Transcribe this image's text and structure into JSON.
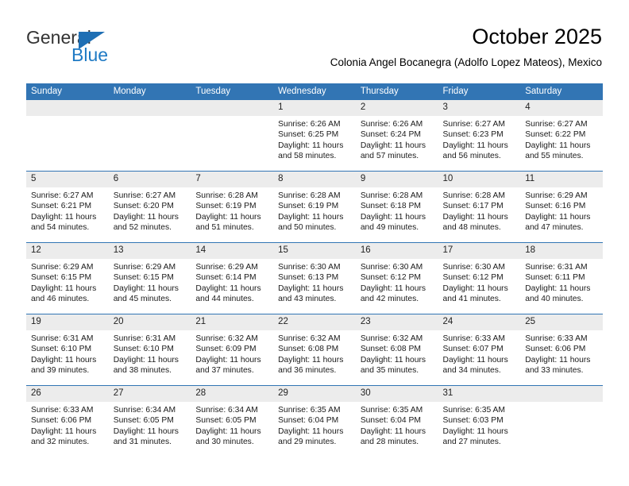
{
  "brand": {
    "name_part1": "General",
    "name_part2": "Blue",
    "flag_color": "#1f6fb4",
    "blue_text_color": "#1f7ac4"
  },
  "header": {
    "title": "October 2025",
    "subtitle": "Colonia Angel Bocanegra (Adolfo Lopez Mateos), Mexico",
    "accent_color": "#3275b4",
    "daynum_band_color": "#ececec"
  },
  "weekday_headers": [
    "Sunday",
    "Monday",
    "Tuesday",
    "Wednesday",
    "Thursday",
    "Friday",
    "Saturday"
  ],
  "weeks": [
    [
      {
        "day": "",
        "empty": true,
        "sunrise": "",
        "sunset": "",
        "daylight_line1": "",
        "daylight_line2": ""
      },
      {
        "day": "",
        "empty": true,
        "sunrise": "",
        "sunset": "",
        "daylight_line1": "",
        "daylight_line2": ""
      },
      {
        "day": "",
        "empty": true,
        "sunrise": "",
        "sunset": "",
        "daylight_line1": "",
        "daylight_line2": ""
      },
      {
        "day": "1",
        "empty": false,
        "sunrise": "Sunrise: 6:26 AM",
        "sunset": "Sunset: 6:25 PM",
        "daylight_line1": "Daylight: 11 hours",
        "daylight_line2": "and 58 minutes."
      },
      {
        "day": "2",
        "empty": false,
        "sunrise": "Sunrise: 6:26 AM",
        "sunset": "Sunset: 6:24 PM",
        "daylight_line1": "Daylight: 11 hours",
        "daylight_line2": "and 57 minutes."
      },
      {
        "day": "3",
        "empty": false,
        "sunrise": "Sunrise: 6:27 AM",
        "sunset": "Sunset: 6:23 PM",
        "daylight_line1": "Daylight: 11 hours",
        "daylight_line2": "and 56 minutes."
      },
      {
        "day": "4",
        "empty": false,
        "sunrise": "Sunrise: 6:27 AM",
        "sunset": "Sunset: 6:22 PM",
        "daylight_line1": "Daylight: 11 hours",
        "daylight_line2": "and 55 minutes."
      }
    ],
    [
      {
        "day": "5",
        "empty": false,
        "sunrise": "Sunrise: 6:27 AM",
        "sunset": "Sunset: 6:21 PM",
        "daylight_line1": "Daylight: 11 hours",
        "daylight_line2": "and 54 minutes."
      },
      {
        "day": "6",
        "empty": false,
        "sunrise": "Sunrise: 6:27 AM",
        "sunset": "Sunset: 6:20 PM",
        "daylight_line1": "Daylight: 11 hours",
        "daylight_line2": "and 52 minutes."
      },
      {
        "day": "7",
        "empty": false,
        "sunrise": "Sunrise: 6:28 AM",
        "sunset": "Sunset: 6:19 PM",
        "daylight_line1": "Daylight: 11 hours",
        "daylight_line2": "and 51 minutes."
      },
      {
        "day": "8",
        "empty": false,
        "sunrise": "Sunrise: 6:28 AM",
        "sunset": "Sunset: 6:19 PM",
        "daylight_line1": "Daylight: 11 hours",
        "daylight_line2": "and 50 minutes."
      },
      {
        "day": "9",
        "empty": false,
        "sunrise": "Sunrise: 6:28 AM",
        "sunset": "Sunset: 6:18 PM",
        "daylight_line1": "Daylight: 11 hours",
        "daylight_line2": "and 49 minutes."
      },
      {
        "day": "10",
        "empty": false,
        "sunrise": "Sunrise: 6:28 AM",
        "sunset": "Sunset: 6:17 PM",
        "daylight_line1": "Daylight: 11 hours",
        "daylight_line2": "and 48 minutes."
      },
      {
        "day": "11",
        "empty": false,
        "sunrise": "Sunrise: 6:29 AM",
        "sunset": "Sunset: 6:16 PM",
        "daylight_line1": "Daylight: 11 hours",
        "daylight_line2": "and 47 minutes."
      }
    ],
    [
      {
        "day": "12",
        "empty": false,
        "sunrise": "Sunrise: 6:29 AM",
        "sunset": "Sunset: 6:15 PM",
        "daylight_line1": "Daylight: 11 hours",
        "daylight_line2": "and 46 minutes."
      },
      {
        "day": "13",
        "empty": false,
        "sunrise": "Sunrise: 6:29 AM",
        "sunset": "Sunset: 6:15 PM",
        "daylight_line1": "Daylight: 11 hours",
        "daylight_line2": "and 45 minutes."
      },
      {
        "day": "14",
        "empty": false,
        "sunrise": "Sunrise: 6:29 AM",
        "sunset": "Sunset: 6:14 PM",
        "daylight_line1": "Daylight: 11 hours",
        "daylight_line2": "and 44 minutes."
      },
      {
        "day": "15",
        "empty": false,
        "sunrise": "Sunrise: 6:30 AM",
        "sunset": "Sunset: 6:13 PM",
        "daylight_line1": "Daylight: 11 hours",
        "daylight_line2": "and 43 minutes."
      },
      {
        "day": "16",
        "empty": false,
        "sunrise": "Sunrise: 6:30 AM",
        "sunset": "Sunset: 6:12 PM",
        "daylight_line1": "Daylight: 11 hours",
        "daylight_line2": "and 42 minutes."
      },
      {
        "day": "17",
        "empty": false,
        "sunrise": "Sunrise: 6:30 AM",
        "sunset": "Sunset: 6:12 PM",
        "daylight_line1": "Daylight: 11 hours",
        "daylight_line2": "and 41 minutes."
      },
      {
        "day": "18",
        "empty": false,
        "sunrise": "Sunrise: 6:31 AM",
        "sunset": "Sunset: 6:11 PM",
        "daylight_line1": "Daylight: 11 hours",
        "daylight_line2": "and 40 minutes."
      }
    ],
    [
      {
        "day": "19",
        "empty": false,
        "sunrise": "Sunrise: 6:31 AM",
        "sunset": "Sunset: 6:10 PM",
        "daylight_line1": "Daylight: 11 hours",
        "daylight_line2": "and 39 minutes."
      },
      {
        "day": "20",
        "empty": false,
        "sunrise": "Sunrise: 6:31 AM",
        "sunset": "Sunset: 6:10 PM",
        "daylight_line1": "Daylight: 11 hours",
        "daylight_line2": "and 38 minutes."
      },
      {
        "day": "21",
        "empty": false,
        "sunrise": "Sunrise: 6:32 AM",
        "sunset": "Sunset: 6:09 PM",
        "daylight_line1": "Daylight: 11 hours",
        "daylight_line2": "and 37 minutes."
      },
      {
        "day": "22",
        "empty": false,
        "sunrise": "Sunrise: 6:32 AM",
        "sunset": "Sunset: 6:08 PM",
        "daylight_line1": "Daylight: 11 hours",
        "daylight_line2": "and 36 minutes."
      },
      {
        "day": "23",
        "empty": false,
        "sunrise": "Sunrise: 6:32 AM",
        "sunset": "Sunset: 6:08 PM",
        "daylight_line1": "Daylight: 11 hours",
        "daylight_line2": "and 35 minutes."
      },
      {
        "day": "24",
        "empty": false,
        "sunrise": "Sunrise: 6:33 AM",
        "sunset": "Sunset: 6:07 PM",
        "daylight_line1": "Daylight: 11 hours",
        "daylight_line2": "and 34 minutes."
      },
      {
        "day": "25",
        "empty": false,
        "sunrise": "Sunrise: 6:33 AM",
        "sunset": "Sunset: 6:06 PM",
        "daylight_line1": "Daylight: 11 hours",
        "daylight_line2": "and 33 minutes."
      }
    ],
    [
      {
        "day": "26",
        "empty": false,
        "sunrise": "Sunrise: 6:33 AM",
        "sunset": "Sunset: 6:06 PM",
        "daylight_line1": "Daylight: 11 hours",
        "daylight_line2": "and 32 minutes."
      },
      {
        "day": "27",
        "empty": false,
        "sunrise": "Sunrise: 6:34 AM",
        "sunset": "Sunset: 6:05 PM",
        "daylight_line1": "Daylight: 11 hours",
        "daylight_line2": "and 31 minutes."
      },
      {
        "day": "28",
        "empty": false,
        "sunrise": "Sunrise: 6:34 AM",
        "sunset": "Sunset: 6:05 PM",
        "daylight_line1": "Daylight: 11 hours",
        "daylight_line2": "and 30 minutes."
      },
      {
        "day": "29",
        "empty": false,
        "sunrise": "Sunrise: 6:35 AM",
        "sunset": "Sunset: 6:04 PM",
        "daylight_line1": "Daylight: 11 hours",
        "daylight_line2": "and 29 minutes."
      },
      {
        "day": "30",
        "empty": false,
        "sunrise": "Sunrise: 6:35 AM",
        "sunset": "Sunset: 6:04 PM",
        "daylight_line1": "Daylight: 11 hours",
        "daylight_line2": "and 28 minutes."
      },
      {
        "day": "31",
        "empty": false,
        "sunrise": "Sunrise: 6:35 AM",
        "sunset": "Sunset: 6:03 PM",
        "daylight_line1": "Daylight: 11 hours",
        "daylight_line2": "and 27 minutes."
      },
      {
        "day": "",
        "empty": true,
        "sunrise": "",
        "sunset": "",
        "daylight_line1": "",
        "daylight_line2": ""
      }
    ]
  ]
}
